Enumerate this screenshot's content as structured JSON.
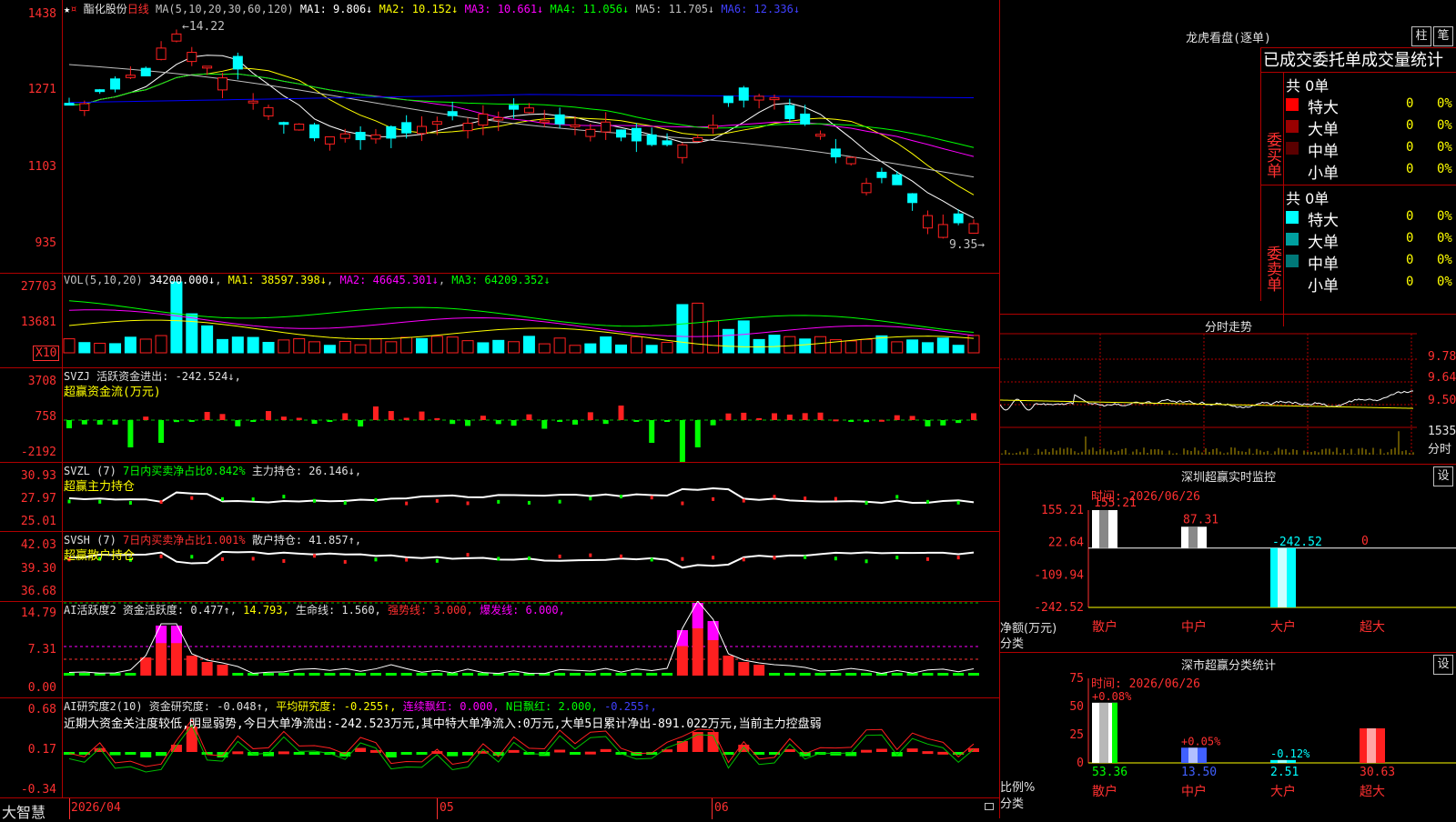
{
  "colors": {
    "up": "#ff2020",
    "down": "#00ffff",
    "ma1": "#ffffff",
    "ma2": "#ffff00",
    "ma3": "#ff00ff",
    "ma4": "#00ff00",
    "ma5": "#c0c0c0",
    "ma6": "#0000ff",
    "grid": "#b00000",
    "axis": "#ff3030"
  },
  "header": {
    "star": "★",
    "stock": "酯化股份",
    "period": "日线",
    "ma_text": "MA(5,10,20,30,60,120)",
    "mas": [
      {
        "k": "MA1: ",
        "v": "9.806↓"
      },
      {
        "k": "MA2: ",
        "v": "10.152↓"
      },
      {
        "k": "MA3: ",
        "v": "10.661↓"
      },
      {
        "k": "MA4: ",
        "v": "11.056↓"
      },
      {
        "k": "MA5: ",
        "v": "11.705↓"
      },
      {
        "k": "MA6: ",
        "v": "12.336↓"
      }
    ],
    "high_label": "←14.22",
    "low_label": "9.35→"
  },
  "price_axis": [
    "1438",
    "1271",
    "1103",
    "935"
  ],
  "vol": {
    "title": "VOL(5,10,20)",
    "value": "34200.000↓",
    "ma1": "MA1: 38597.398↓",
    "ma2": "MA2: 46645.301↓",
    "ma3": "MA3: 64209.352↓",
    "axis": [
      "27703",
      "13681"
    ],
    "unit": "X10"
  },
  "svzj": {
    "title": "SVZJ  活跃资金进出: -242.524↓,",
    "sub": "超赢资金流(万元)",
    "axis": [
      "3708",
      "758",
      "-2192"
    ]
  },
  "svzl": {
    "title": "SVZL (7)",
    "p1": "7日内买卖净占比0.842%",
    "p2": "主力持仓: 26.146↓,",
    "sub": "超赢主力持仓",
    "axis": [
      "30.93",
      "27.97",
      "25.01"
    ]
  },
  "svsh": {
    "title": "SVSH (7)",
    "p1": "7日内买卖净占比1.001%",
    "p2": "散户持仓: 41.857↑,",
    "sub": "超赢散户持仓",
    "axis": [
      "42.03",
      "39.30",
      "36.68"
    ]
  },
  "ai1": {
    "t1": "AI活跃度2 资金活跃度: 0.477↑,",
    "t2": "14.793,",
    "t3": "生命线: 1.560,",
    "t4": "强势线: 3.000,",
    "t5": "爆发线: 6.000,",
    "axis": [
      "14.79",
      "7.31",
      "0.00"
    ]
  },
  "ai2": {
    "t1": "AI研究度2(10) 资金研究度: -0.048↑,",
    "t2": "平均研究度: -0.255↑,",
    "t3": "连续飘红: 0.000,",
    "t4": "N日飘红: 2.000,",
    "t5": "-0.255↑,",
    "comment": "近期大资金关注度较低,明显弱势,今日大单净流出:-242.523万元,其中特大单净流入:0万元,大单5日累计净出-891.022万元,当前主力控盘弱",
    "axis": [
      "0.68",
      "0.17",
      "-0.34"
    ]
  },
  "bottom": {
    "brand": "大智慧",
    "date1": "2026/04",
    "date2": "05",
    "date3": "06"
  },
  "dragon": {
    "title": "龙虎看盘(逐单)",
    "btn1": "柱",
    "btn2": "笔",
    "head": "已成交委托单成交量统计",
    "buy": {
      "label": "委买单",
      "total": "共 0单",
      "rows": [
        {
          "name": "特大",
          "n": "0",
          "p": "0%",
          "c": "#ff0000"
        },
        {
          "name": "大单",
          "n": "0",
          "p": "0%",
          "c": "#9a0000"
        },
        {
          "name": "中单",
          "n": "0",
          "p": "0%",
          "c": "#5a0000"
        },
        {
          "name": "小单",
          "n": "0",
          "p": "0%",
          "c": ""
        }
      ]
    },
    "sell": {
      "label": "委卖单",
      "total": "共 0单",
      "rows": [
        {
          "name": "特大",
          "n": "0",
          "p": "0%",
          "c": "#00ffff"
        },
        {
          "name": "大单",
          "n": "0",
          "p": "0%",
          "c": "#00a0a0"
        },
        {
          "name": "中单",
          "n": "0",
          "p": "0%",
          "c": "#007878"
        },
        {
          "name": "小单",
          "n": "0",
          "p": "0%",
          "c": ""
        }
      ]
    }
  },
  "intraday": {
    "title": "分时走势",
    "axis": [
      "9.78",
      "9.64",
      "9.50"
    ],
    "vol_axis": "1535",
    "vol_unit": "分时"
  },
  "monitor": {
    "title": "深圳超赢实时监控",
    "btn": "设",
    "time": "时间: 2026/06/26",
    "axis": [
      "155.21",
      "22.64",
      "-109.94",
      "-242.52"
    ],
    "ylabel": "净额(万元)",
    "xlabel": "分类",
    "bars": [
      {
        "cat": "散户",
        "v": 155.21,
        "label": "155.21"
      },
      {
        "cat": "中户",
        "v": 87.31,
        "label": "87.31"
      },
      {
        "cat": "大户",
        "v": -242.52,
        "label": "-242.52"
      },
      {
        "cat": "超大",
        "v": 0,
        "label": "0"
      }
    ]
  },
  "classify": {
    "title": "深市超赢分类统计",
    "btn": "设",
    "time": "时间: 2026/06/26",
    "axis": [
      "75",
      "50",
      "25",
      "0"
    ],
    "ylabel": "比例%",
    "xlabel": "分类",
    "bars": [
      {
        "cat": "散户",
        "v": 53.36,
        "top": "+0.08%",
        "bottom": "53.36"
      },
      {
        "cat": "中户",
        "v": 13.5,
        "top": "+0.05%",
        "bottom": "13.50"
      },
      {
        "cat": "大户",
        "v": 2.51,
        "top": "-0.12%",
        "bottom": "2.51"
      },
      {
        "cat": "超大",
        "v": 30.63,
        "top": "",
        "bottom": "30.63"
      }
    ]
  }
}
